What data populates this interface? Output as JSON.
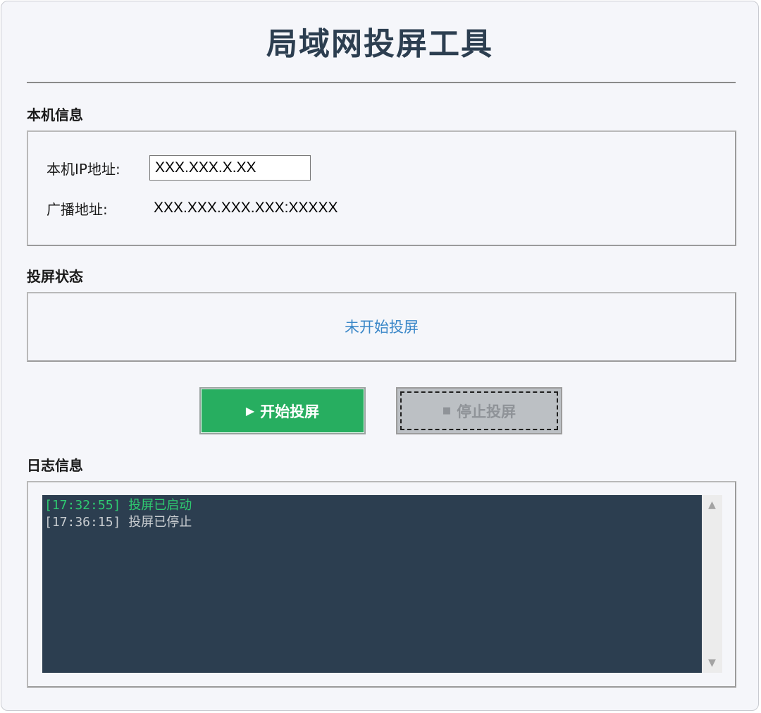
{
  "app": {
    "title": "局域网投屏工具"
  },
  "local_info": {
    "section_label": "本机信息",
    "ip_label": "本机IP地址:",
    "ip_value": "XXX.XXX.X.XX",
    "broadcast_label": "广播地址:",
    "broadcast_value": "XXX.XXX.XXX.XXX:XXXXX"
  },
  "cast_status": {
    "section_label": "投屏状态",
    "status_text": "未开始投屏",
    "status_color": "#3a87c8"
  },
  "controls": {
    "start_label": "开始投屏",
    "start_icon": "play-icon",
    "stop_label": "停止投屏",
    "stop_icon": "stop-square-icon",
    "start_color": "#27ae60",
    "stop_disabled_color": "#bcc0c4"
  },
  "log": {
    "section_label": "日志信息",
    "background_color": "#2c3e50",
    "entries": [
      {
        "time": "[17:32:55]",
        "message": "投屏已启动",
        "color": "#2ecc71"
      },
      {
        "time": "[17:36:15]",
        "message": "投屏已停止",
        "color": "#c8ccd0"
      }
    ]
  }
}
